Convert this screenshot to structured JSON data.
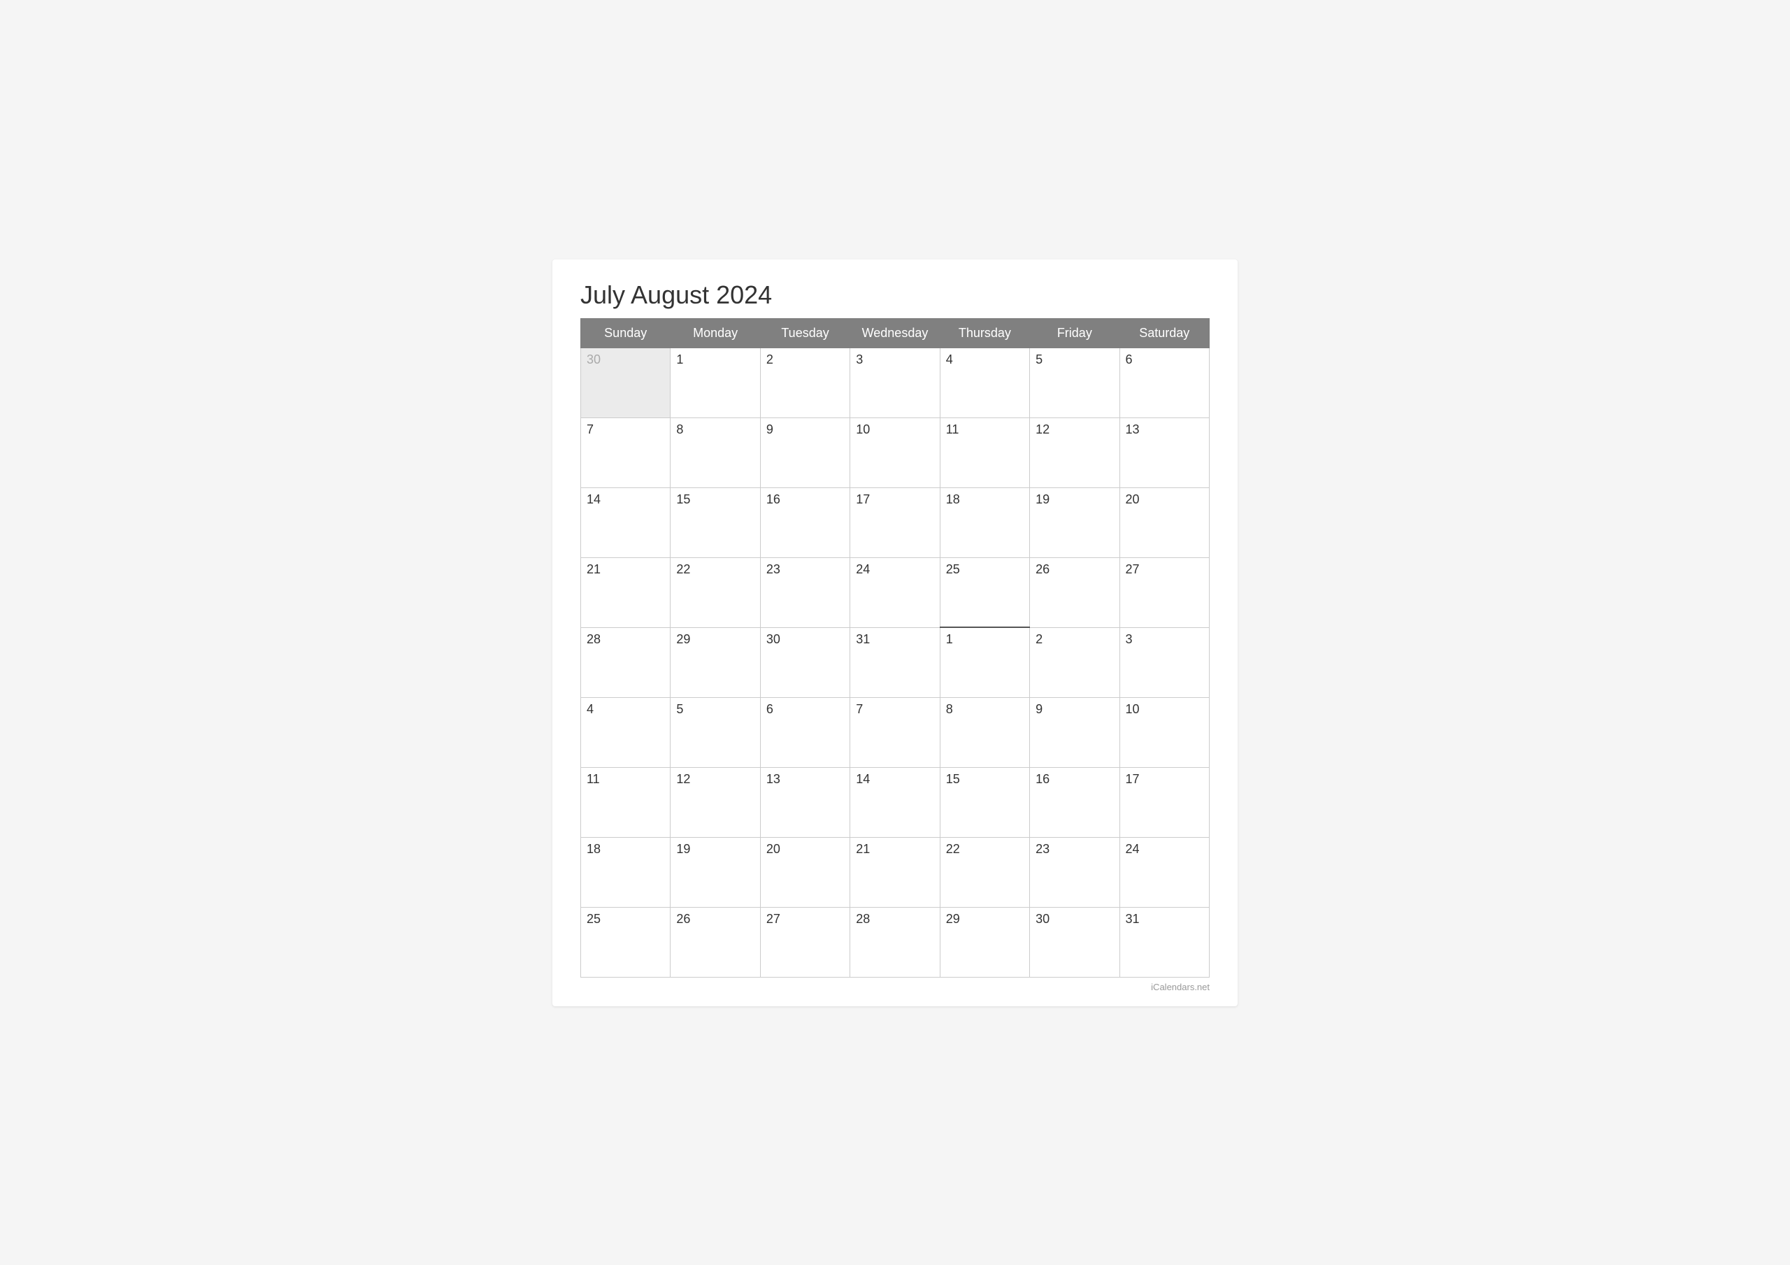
{
  "calendar": {
    "title": "July August 2024",
    "header": {
      "days": [
        "Sunday",
        "Monday",
        "Tuesday",
        "Wednesday",
        "Thursday",
        "Friday",
        "Saturday"
      ]
    },
    "weeks": [
      {
        "cells": [
          {
            "day": "30",
            "month": "other"
          },
          {
            "day": "1",
            "month": "current"
          },
          {
            "day": "2",
            "month": "current"
          },
          {
            "day": "3",
            "month": "current"
          },
          {
            "day": "4",
            "month": "current"
          },
          {
            "day": "5",
            "month": "current"
          },
          {
            "day": "6",
            "month": "current"
          }
        ]
      },
      {
        "cells": [
          {
            "day": "7",
            "month": "current"
          },
          {
            "day": "8",
            "month": "current"
          },
          {
            "day": "9",
            "month": "current"
          },
          {
            "day": "10",
            "month": "current"
          },
          {
            "day": "11",
            "month": "current"
          },
          {
            "day": "12",
            "month": "current"
          },
          {
            "day": "13",
            "month": "current"
          }
        ]
      },
      {
        "cells": [
          {
            "day": "14",
            "month": "current"
          },
          {
            "day": "15",
            "month": "current"
          },
          {
            "day": "16",
            "month": "current"
          },
          {
            "day": "17",
            "month": "current"
          },
          {
            "day": "18",
            "month": "current"
          },
          {
            "day": "19",
            "month": "current"
          },
          {
            "day": "20",
            "month": "current"
          }
        ]
      },
      {
        "cells": [
          {
            "day": "21",
            "month": "current"
          },
          {
            "day": "22",
            "month": "current"
          },
          {
            "day": "23",
            "month": "current"
          },
          {
            "day": "24",
            "month": "current"
          },
          {
            "day": "25",
            "month": "current"
          },
          {
            "day": "26",
            "month": "current"
          },
          {
            "day": "27",
            "month": "current"
          }
        ]
      },
      {
        "cells": [
          {
            "day": "28",
            "month": "current"
          },
          {
            "day": "29",
            "month": "current"
          },
          {
            "day": "30",
            "month": "current"
          },
          {
            "day": "31",
            "month": "current"
          },
          {
            "day": "1",
            "month": "next",
            "boundary": true
          },
          {
            "day": "2",
            "month": "next"
          },
          {
            "day": "3",
            "month": "next"
          }
        ]
      },
      {
        "cells": [
          {
            "day": "4",
            "month": "next"
          },
          {
            "day": "5",
            "month": "next"
          },
          {
            "day": "6",
            "month": "next"
          },
          {
            "day": "7",
            "month": "next"
          },
          {
            "day": "8",
            "month": "next"
          },
          {
            "day": "9",
            "month": "next"
          },
          {
            "day": "10",
            "month": "next"
          }
        ]
      },
      {
        "cells": [
          {
            "day": "11",
            "month": "next"
          },
          {
            "day": "12",
            "month": "next"
          },
          {
            "day": "13",
            "month": "next"
          },
          {
            "day": "14",
            "month": "next"
          },
          {
            "day": "15",
            "month": "next"
          },
          {
            "day": "16",
            "month": "next"
          },
          {
            "day": "17",
            "month": "next"
          }
        ]
      },
      {
        "cells": [
          {
            "day": "18",
            "month": "next"
          },
          {
            "day": "19",
            "month": "next"
          },
          {
            "day": "20",
            "month": "next"
          },
          {
            "day": "21",
            "month": "next"
          },
          {
            "day": "22",
            "month": "next"
          },
          {
            "day": "23",
            "month": "next"
          },
          {
            "day": "24",
            "month": "next"
          }
        ]
      },
      {
        "cells": [
          {
            "day": "25",
            "month": "next"
          },
          {
            "day": "26",
            "month": "next"
          },
          {
            "day": "27",
            "month": "next"
          },
          {
            "day": "28",
            "month": "next"
          },
          {
            "day": "29",
            "month": "next"
          },
          {
            "day": "30",
            "month": "next"
          },
          {
            "day": "31",
            "month": "next"
          }
        ]
      }
    ],
    "watermark": "iCalendars.net"
  }
}
